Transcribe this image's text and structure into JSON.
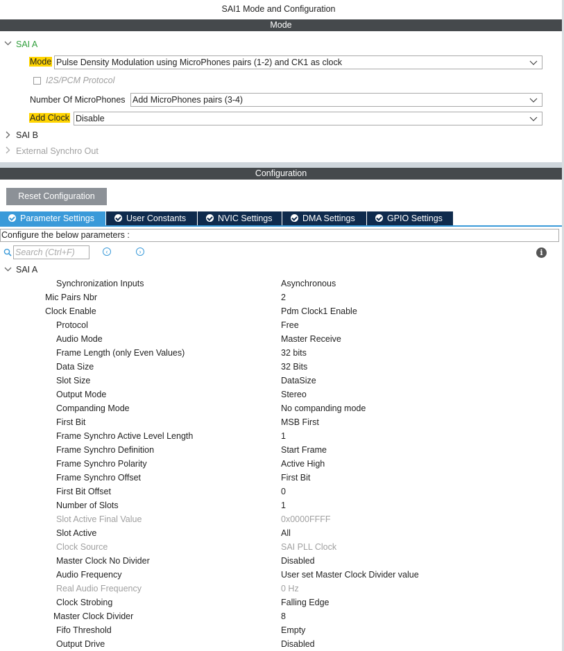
{
  "window_title": "SAI1 Mode and Configuration",
  "mode_band": "Mode",
  "config_band": "Configuration",
  "mode": {
    "sai_a": "SAI A",
    "mode_label": "Mode",
    "mode_value": "Pulse Density Modulation using MicroPhones pairs (1-2) and CK1 as clock",
    "i2s_label": "I2S/PCM Protocol",
    "num_mic_label": "Number Of MicroPhones",
    "num_mic_value": "Add MicroPhones pairs (3-4)",
    "add_clock_label": "Add Clock",
    "add_clock_value": "Disable",
    "sai_b": "SAI B",
    "ext_sync": "External Synchro Out"
  },
  "toolbar": {
    "reset_label": "Reset Configuration"
  },
  "tabs": [
    {
      "label": "Parameter Settings",
      "active": true
    },
    {
      "label": "User Constants",
      "active": false
    },
    {
      "label": "NVIC Settings",
      "active": false
    },
    {
      "label": "DMA Settings",
      "active": false
    },
    {
      "label": "GPIO Settings",
      "active": false
    }
  ],
  "config_hint": "Configure the below parameters :",
  "search": {
    "placeholder": "Search (Ctrl+F)"
  },
  "params_group": "SAI A",
  "params": [
    {
      "key": "Synchronization Inputs",
      "value": "Asynchronous",
      "enabled": true
    },
    {
      "key": "Mic Pairs Nbr",
      "value": "2",
      "enabled": true
    },
    {
      "key": "Clock Enable",
      "value": "Pdm Clock1 Enable",
      "enabled": true
    },
    {
      "key": "Protocol",
      "value": "Free",
      "enabled": true
    },
    {
      "key": "Audio Mode",
      "value": "Master Receive",
      "enabled": true
    },
    {
      "key": "Frame Length (only Even Values)",
      "value": "32 bits",
      "enabled": true
    },
    {
      "key": "Data Size",
      "value": "32 Bits",
      "enabled": true
    },
    {
      "key": "Slot Size",
      "value": "DataSize",
      "enabled": true
    },
    {
      "key": "Output Mode",
      "value": "Stereo",
      "enabled": true
    },
    {
      "key": "Companding Mode",
      "value": "No companding mode",
      "enabled": true
    },
    {
      "key": "First Bit",
      "value": "MSB First",
      "enabled": true
    },
    {
      "key": "Frame Synchro Active Level Length",
      "value": "1",
      "enabled": true
    },
    {
      "key": "Frame Synchro Definition",
      "value": "Start Frame",
      "enabled": true
    },
    {
      "key": "Frame Synchro Polarity",
      "value": "Active High",
      "enabled": true
    },
    {
      "key": "Frame Synchro Offset",
      "value": "First Bit",
      "enabled": true
    },
    {
      "key": "First Bit Offset",
      "value": "0",
      "enabled": true
    },
    {
      "key": "Number of Slots",
      "value": "1",
      "enabled": true
    },
    {
      "key": "Slot Active Final Value",
      "value": "0x0000FFFF",
      "enabled": false
    },
    {
      "key": "Slot Active",
      "value": "All",
      "enabled": true
    },
    {
      "key": "Clock Source",
      "value": "SAI PLL Clock",
      "enabled": false
    },
    {
      "key": "Master Clock No Divider",
      "value": "Disabled",
      "enabled": true
    },
    {
      "key": "Audio Frequency",
      "value": "User set Master Clock Divider value",
      "enabled": true
    },
    {
      "key": "Real Audio Frequency",
      "value": "0 Hz",
      "enabled": false
    },
    {
      "key": "Clock Strobing",
      "value": "Falling Edge",
      "enabled": true
    },
    {
      "key": "Master Clock Divider",
      "value": "8",
      "enabled": true
    },
    {
      "key": "Fifo Threshold",
      "value": "Empty",
      "enabled": true
    },
    {
      "key": "Output Drive",
      "value": "Disabled",
      "enabled": true
    }
  ],
  "colors": {
    "band": "#45494c",
    "accent_tab": "#3a9ad9",
    "tab_dark": "#0f2b4d",
    "highlight": "#ffd400",
    "sai_a_green": "#2e9e3a",
    "disabled_text": "#a0a0a0"
  }
}
